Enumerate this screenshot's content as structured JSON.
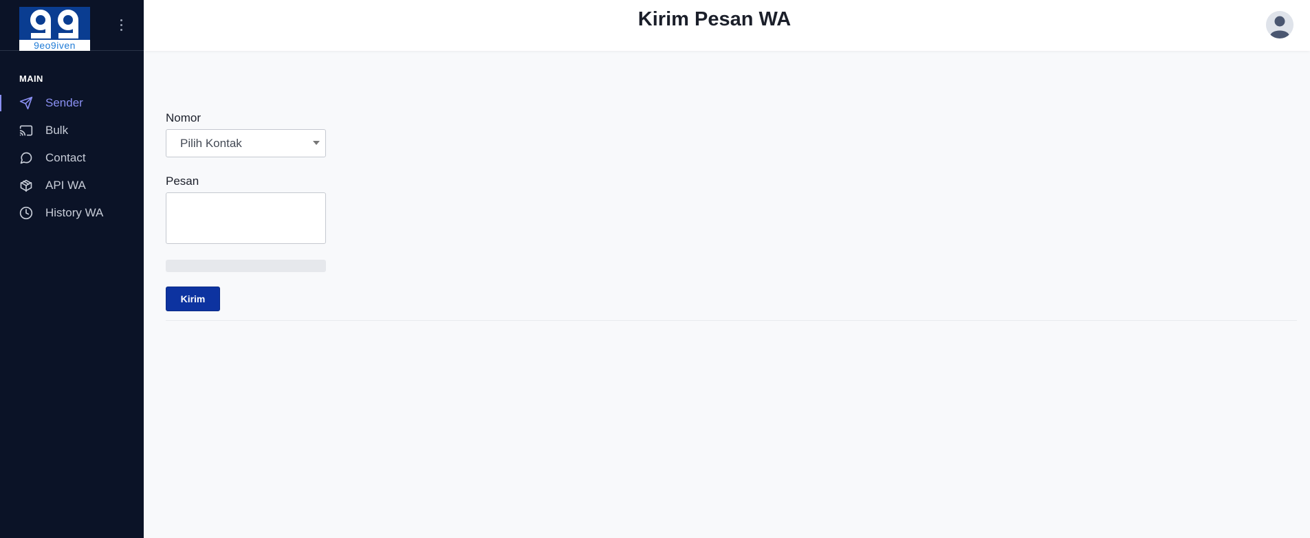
{
  "app": {
    "logo_text": "99",
    "logo_strip": "9eo9iven"
  },
  "sidebar": {
    "section": "MAIN",
    "items": [
      {
        "label": "Sender",
        "icon": "send-icon",
        "active": true
      },
      {
        "label": "Bulk",
        "icon": "cast-icon",
        "active": false
      },
      {
        "label": "Contact",
        "icon": "message-circle-icon",
        "active": false
      },
      {
        "label": "API WA",
        "icon": "package-icon",
        "active": false
      },
      {
        "label": "History WA",
        "icon": "clock-icon",
        "active": false
      }
    ]
  },
  "header": {
    "title": "Kirim Pesan WA",
    "avatar_icon": "user-avatar-icon"
  },
  "form": {
    "nomor_label": "Nomor",
    "nomor_value": "Pilih Kontak",
    "pesan_label": "Pesan",
    "pesan_value": "",
    "progress": 0,
    "submit_label": "Kirim"
  },
  "colors": {
    "sidebar_bg": "#0b1327",
    "accent": "#8a8ff2",
    "primary_button": "#0d33a0",
    "page_bg": "#f8f9fb"
  }
}
